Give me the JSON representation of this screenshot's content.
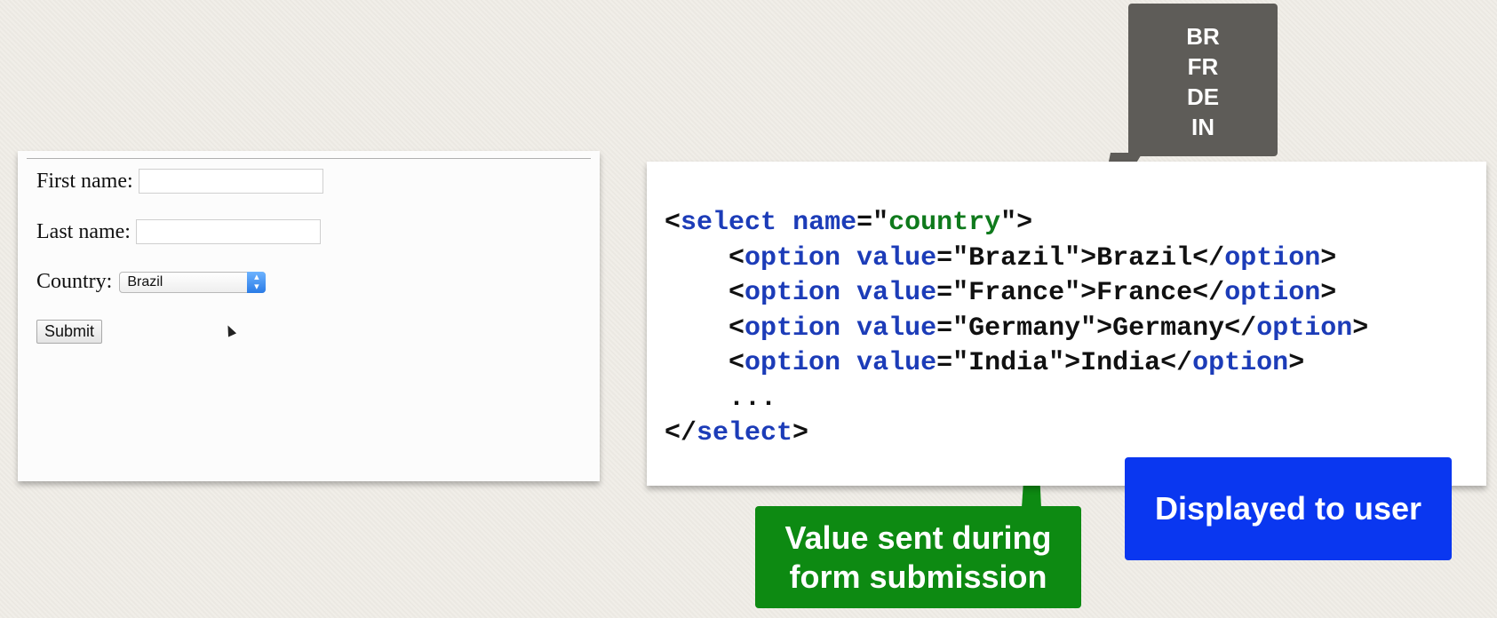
{
  "form": {
    "first_name_label": "First name:",
    "last_name_label": "Last name:",
    "country_label": "Country:",
    "country_selected": "Brazil",
    "submit_label": "Submit"
  },
  "code": {
    "select_open_tag": "select",
    "select_attr": "name",
    "select_attr_value": "country",
    "options": [
      {
        "value": "Brazil",
        "text": "Brazil"
      },
      {
        "value": "France",
        "text": "France"
      },
      {
        "value": "Germany",
        "text": "Germany"
      },
      {
        "value": "India",
        "text": "India"
      }
    ],
    "ellipsis": "...",
    "select_close_tag": "select"
  },
  "callouts": {
    "codes": [
      "BR",
      "FR",
      "DE",
      "IN"
    ],
    "displayed": "Displayed to user",
    "value_line1": "Value sent during",
    "value_line2": "form submission"
  },
  "colors": {
    "grey_callout": "#5e5c58",
    "blue_callout": "#0a37f0",
    "green_callout": "#0d8a12",
    "code_tag": "#1c3cb8",
    "code_string": "#0f7a1c"
  }
}
